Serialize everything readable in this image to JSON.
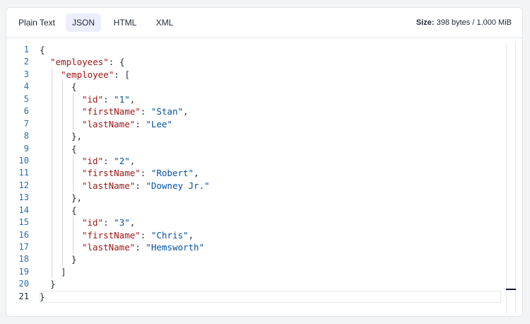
{
  "tabs": [
    {
      "label": "Plain Text",
      "active": false
    },
    {
      "label": "JSON",
      "active": true
    },
    {
      "label": "HTML",
      "active": false
    },
    {
      "label": "XML",
      "active": false
    }
  ],
  "size": {
    "label": "Size:",
    "value": "398 bytes / 1.000 MiB"
  },
  "editor": {
    "current_line": 21,
    "lines": [
      {
        "n": "1",
        "text": "{"
      },
      {
        "n": "2",
        "text": "\"employees\": {"
      },
      {
        "n": "3",
        "text": "\"employee\": ["
      },
      {
        "n": "4",
        "text": "{"
      },
      {
        "n": "5",
        "text": "\"id\": \"1\","
      },
      {
        "n": "6",
        "text": "\"firstName\": \"Stan\","
      },
      {
        "n": "7",
        "text": "\"lastName\": \"Lee\""
      },
      {
        "n": "8",
        "text": "},"
      },
      {
        "n": "9",
        "text": "{"
      },
      {
        "n": "10",
        "text": "\"id\": \"2\","
      },
      {
        "n": "11",
        "text": "\"firstName\": \"Robert\","
      },
      {
        "n": "12",
        "text": "\"lastName\": \"Downey Jr.\""
      },
      {
        "n": "13",
        "text": "},"
      },
      {
        "n": "14",
        "text": "{"
      },
      {
        "n": "15",
        "text": "\"id\": \"3\","
      },
      {
        "n": "16",
        "text": "\"firstName\": \"Chris\","
      },
      {
        "n": "17",
        "text": "\"lastName\": \"Hemsworth\""
      },
      {
        "n": "18",
        "text": "}"
      },
      {
        "n": "19",
        "text": "]"
      },
      {
        "n": "20",
        "text": "}"
      },
      {
        "n": "21",
        "text": "}"
      }
    ]
  },
  "colors": {
    "key": "#a31515",
    "string": "#0451a5",
    "line_number": "#2b6cb0",
    "active_tab": "#eceefe"
  }
}
